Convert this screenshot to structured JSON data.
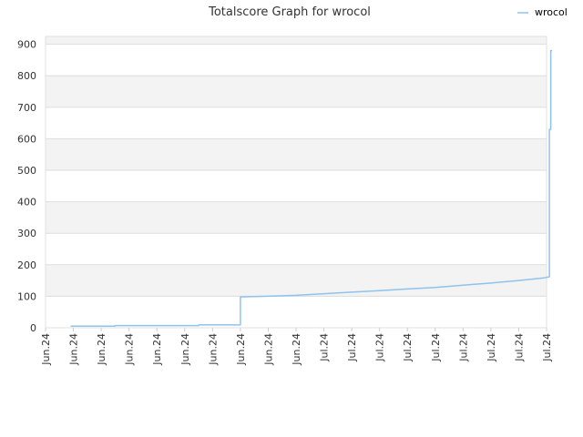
{
  "chart_data": {
    "type": "line",
    "title": "Totalscore Graph for wrocol",
    "xlabel": "",
    "ylabel": "",
    "ylim": [
      0,
      925
    ],
    "y_ticks": [
      0,
      100,
      200,
      300,
      400,
      500,
      600,
      700,
      800,
      900
    ],
    "x_tick_labels": [
      "Jun.24",
      "Jun.24",
      "Jun.24",
      "Jun.24",
      "Jun.24",
      "Jun.24",
      "Jun.24",
      "Jun.24",
      "Jun.24",
      "Jun.24",
      "Jul.24",
      "Jul.24",
      "Jul.24",
      "Jul.24",
      "Jul.24",
      "Jul.24",
      "Jul.24",
      "Jul.24",
      "Jul.24"
    ],
    "grid": true,
    "legend_position": "top-right",
    "colors": {
      "line": "#8ec3ee",
      "band": "#f3f3f3",
      "grid": "#dddddd"
    },
    "series": [
      {
        "name": "wrocol",
        "points": [
          [
            0.9,
            5
          ],
          [
            2.5,
            5
          ],
          [
            2.5,
            7
          ],
          [
            5.5,
            7
          ],
          [
            5.5,
            9
          ],
          [
            7.0,
            9
          ],
          [
            7.0,
            98
          ],
          [
            8.0,
            100
          ],
          [
            9.0,
            103
          ],
          [
            10.0,
            108
          ],
          [
            11.0,
            113
          ],
          [
            12.0,
            118
          ],
          [
            13.0,
            123
          ],
          [
            14.0,
            128
          ],
          [
            15.0,
            135
          ],
          [
            16.0,
            142
          ],
          [
            17.0,
            150
          ],
          [
            17.9,
            158
          ],
          [
            18.1,
            162
          ],
          [
            18.1,
            630
          ],
          [
            18.15,
            630
          ],
          [
            18.15,
            880
          ],
          [
            18.2,
            880
          ]
        ]
      }
    ]
  }
}
